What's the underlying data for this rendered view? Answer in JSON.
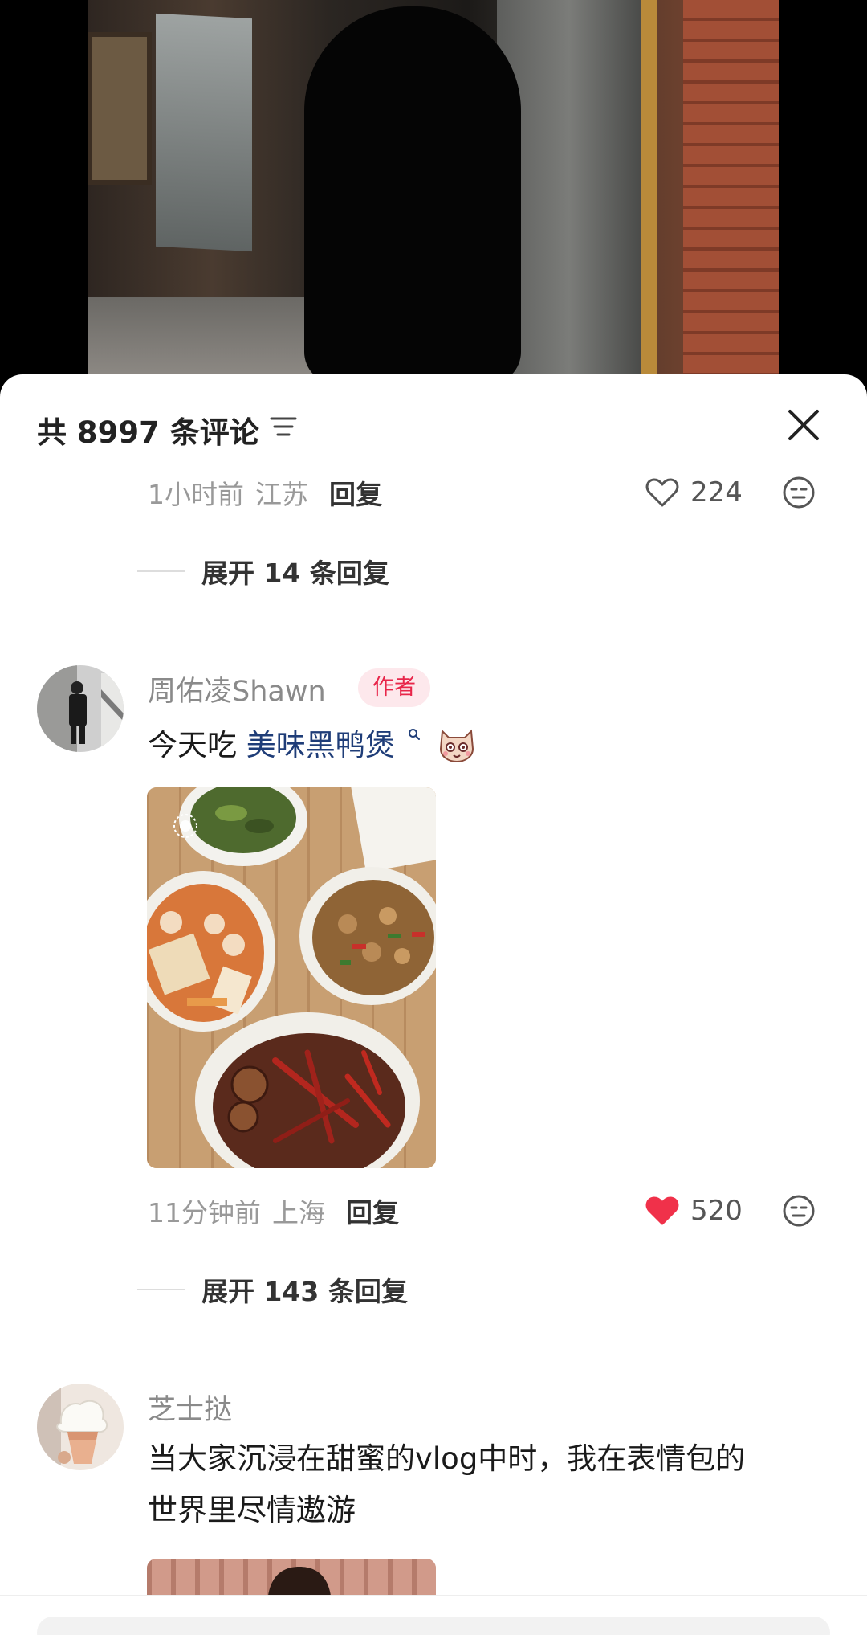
{
  "header": {
    "comment_count": "共 8997 条评论"
  },
  "comments": [
    {
      "meta": {
        "time": "1小时前",
        "location": "江苏",
        "reply_label": "回复"
      },
      "likes": "224",
      "liked": false,
      "expand": "展开 14 条回复"
    },
    {
      "user": "周佑凌Shawn",
      "badge": "作者",
      "text_prefix": "今天吃 ",
      "text_link": "美味黑鸭煲",
      "meta": {
        "time": "11分钟前",
        "location": "上海",
        "reply_label": "回复"
      },
      "likes": "520",
      "liked": true,
      "expand": "展开 143 条回复"
    },
    {
      "user": "芝士挞",
      "text_line1": "当大家沉浸在甜蜜的vlog中时，我在表情包的",
      "text_line2": "世界里尽情遨游"
    }
  ],
  "colors": {
    "like_active": "#f0314a",
    "link": "#1f3d78",
    "badge_text": "#e8264a",
    "badge_bg": "#fde8ec"
  }
}
